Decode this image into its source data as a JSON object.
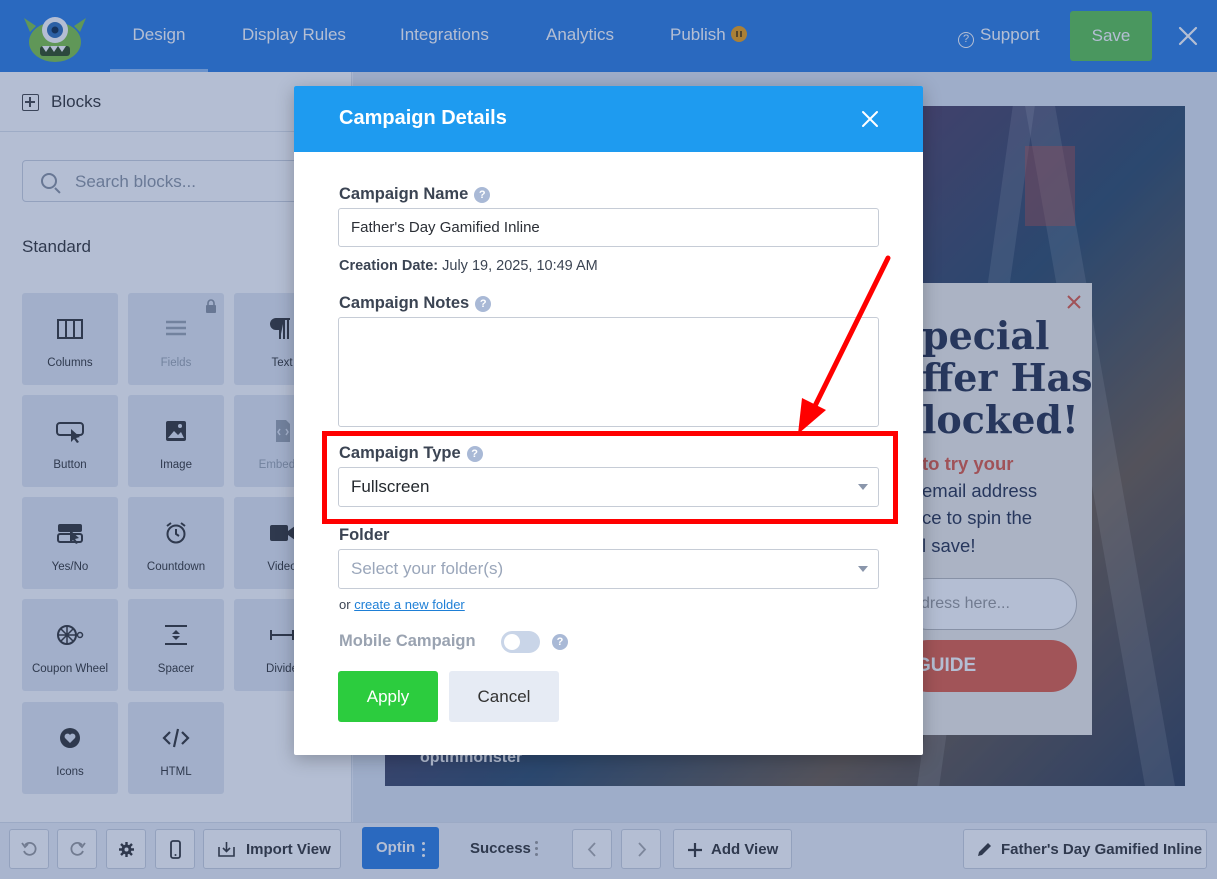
{
  "topbar": {
    "tabs": [
      {
        "label": "Design",
        "active": true
      },
      {
        "label": "Display Rules"
      },
      {
        "label": "Integrations"
      },
      {
        "label": "Analytics"
      },
      {
        "label": "Publish"
      }
    ],
    "support_label": "Support",
    "save_label": "Save"
  },
  "sidebar": {
    "title": "Blocks",
    "search_placeholder": "Search blocks...",
    "section": "Standard",
    "blocks": [
      {
        "label": "Columns"
      },
      {
        "label": "Fields",
        "locked": true
      },
      {
        "label": "Text"
      },
      {
        "label": "Button"
      },
      {
        "label": "Image"
      },
      {
        "label": "Embed F"
      },
      {
        "label": "Yes/No"
      },
      {
        "label": "Countdown"
      },
      {
        "label": "Video"
      },
      {
        "label": "Coupon Wheel"
      },
      {
        "label": "Spacer"
      },
      {
        "label": "Divide"
      },
      {
        "label": "Icons"
      },
      {
        "label": "HTML"
      }
    ]
  },
  "bottombar": {
    "import_label": "Import View",
    "optin_label": "Optin",
    "success_label": "Success",
    "add_view_label": "Add View",
    "campaign_label": "Father's Day Gamified Inline"
  },
  "preview": {
    "headline": [
      "pecial",
      "ffer Has",
      "locked!"
    ],
    "red_line": "to try your",
    "body": [
      "email address",
      "ce to spin the",
      "l save!"
    ],
    "field_placeholder": "dress here...",
    "button": "GUIDE",
    "brand": "optinmonster"
  },
  "modal": {
    "title": "Campaign Details",
    "name_label": "Campaign Name",
    "name_value": "Father's Day Gamified Inline",
    "creation_label": "Creation Date:",
    "creation_value": "July 19, 2025, 10:49 AM",
    "notes_label": "Campaign Notes",
    "type_label": "Campaign Type",
    "type_value": "Fullscreen",
    "folder_label": "Folder",
    "folder_placeholder": "Select your folder(s)",
    "or_text": "or",
    "create_folder_link": "create a new folder",
    "mobile_label": "Mobile Campaign",
    "apply_label": "Apply",
    "cancel_label": "Cancel"
  },
  "colors": {
    "topbar": "#2b7de1",
    "modal_header": "#1e9bf0",
    "save": "#5cc34d",
    "apply": "#2ccc3e",
    "annotation": "#ff0000"
  }
}
